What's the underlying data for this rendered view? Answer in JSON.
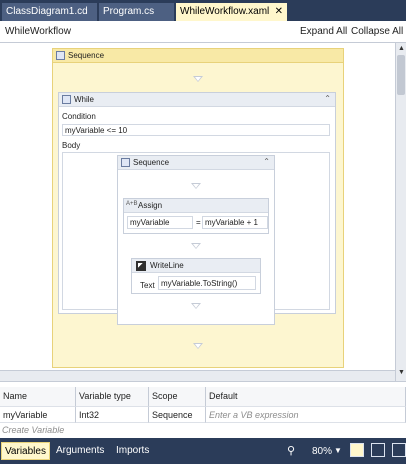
{
  "tabs": [
    {
      "label": "ClassDiagram1.cd"
    },
    {
      "label": "Program.cs"
    },
    {
      "label": "WhileWorkflow.xaml",
      "active": true
    }
  ],
  "header": {
    "title": "WhileWorkflow",
    "expand_all": "Expand All",
    "collapse_all": "Collapse All"
  },
  "designer": {
    "outer_sequence": {
      "title": "Sequence"
    },
    "while": {
      "title": "While",
      "condition_label": "Condition",
      "condition_value": "myVariable <= 10",
      "body_label": "Body"
    },
    "inner_sequence": {
      "title": "Sequence"
    },
    "assign": {
      "title": "Assign",
      "icon_text": "A+B",
      "left_value": "myVariable",
      "operator": "=",
      "right_value": "myVariable + 1"
    },
    "writeline": {
      "title": "WriteLine",
      "text_label": "Text",
      "text_value": "myVariable.ToString()"
    }
  },
  "variables_grid": {
    "columns": [
      "Name",
      "Variable type",
      "Scope",
      "Default"
    ],
    "rows": [
      {
        "name": "myVariable",
        "type": "Int32",
        "scope": "Sequence",
        "default_placeholder": "Enter a VB expression"
      }
    ],
    "create_label": "Create Variable"
  },
  "bottom_bar": {
    "tabs": [
      "Variables",
      "Arguments",
      "Imports"
    ],
    "zoom": "80%"
  },
  "icons": {
    "search": "magnifier-icon",
    "zoom_dropdown": "chevron-down-icon",
    "fit": "fit-to-screen-icon",
    "overview": "overview-icon"
  }
}
